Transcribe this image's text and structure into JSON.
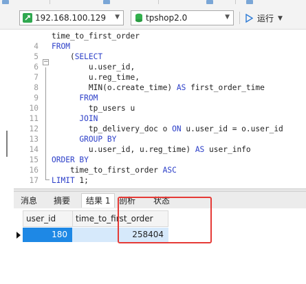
{
  "toolbar": {
    "connection": "192.168.100.129",
    "database": "tpshop2.0",
    "run_label": "运行"
  },
  "editor": {
    "lines": [
      {
        "num": "",
        "tokens": [
          {
            "t": "time_to_first_order",
            "k": false
          }
        ]
      },
      {
        "num": "4",
        "tokens": [
          {
            "t": "FROM",
            "k": true
          }
        ]
      },
      {
        "num": "5",
        "tokens": [
          {
            "t": "    (",
            "k": false
          },
          {
            "t": "SELECT",
            "k": true
          }
        ]
      },
      {
        "num": "6",
        "tokens": [
          {
            "t": "        u.user_id,",
            "k": false
          }
        ]
      },
      {
        "num": "7",
        "tokens": [
          {
            "t": "        u.reg_time,",
            "k": false
          }
        ]
      },
      {
        "num": "8",
        "tokens": [
          {
            "t": "        MIN(o.create_time) ",
            "k": false
          },
          {
            "t": "AS",
            "k": true
          },
          {
            "t": " first_order_time",
            "k": false
          }
        ]
      },
      {
        "num": "9",
        "tokens": [
          {
            "t": "      ",
            "k": false
          },
          {
            "t": "FROM",
            "k": true
          }
        ]
      },
      {
        "num": "10",
        "tokens": [
          {
            "t": "        tp_users u",
            "k": false
          }
        ]
      },
      {
        "num": "11",
        "tokens": [
          {
            "t": "      ",
            "k": false
          },
          {
            "t": "JOIN",
            "k": true
          }
        ]
      },
      {
        "num": "12",
        "tokens": [
          {
            "t": "        tp_delivery_doc o ",
            "k": false
          },
          {
            "t": "ON",
            "k": true
          },
          {
            "t": " u.user_id = o.user_id",
            "k": false
          }
        ]
      },
      {
        "num": "13",
        "tokens": [
          {
            "t": "      ",
            "k": false
          },
          {
            "t": "GROUP BY",
            "k": true
          }
        ]
      },
      {
        "num": "14",
        "tokens": [
          {
            "t": "        u.user_id, u.reg_time) ",
            "k": false
          },
          {
            "t": "AS",
            "k": true
          },
          {
            "t": " user_info",
            "k": false
          }
        ]
      },
      {
        "num": "15",
        "tokens": [
          {
            "t": "ORDER BY",
            "k": true
          }
        ]
      },
      {
        "num": "16",
        "tokens": [
          {
            "t": "    time_to_first_order ",
            "k": false
          },
          {
            "t": "ASC",
            "k": true
          }
        ]
      },
      {
        "num": "17",
        "tokens": [
          {
            "t": "LIMIT",
            "k": true
          },
          {
            "t": " 1;",
            "k": false
          }
        ]
      }
    ]
  },
  "result_tabs": {
    "messages": "消息",
    "summary": "摘要",
    "result1": "结果 1",
    "profile": "剖析",
    "status": "状态"
  },
  "grid": {
    "columns": [
      "user_id",
      "time_to_first_order"
    ],
    "rows": [
      {
        "user_id": "180",
        "time_to_first_order": "258404"
      }
    ]
  },
  "colors": {
    "keyword": "#2b3ec8",
    "selection": "#1e88e5",
    "annotation": "#e53935"
  }
}
